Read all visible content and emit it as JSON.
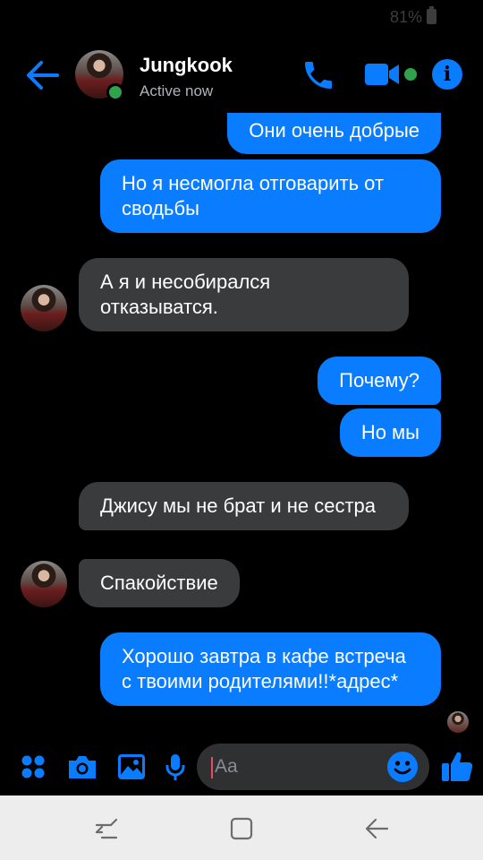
{
  "status_bar": {
    "battery": "81%"
  },
  "header": {
    "contact_name": "Jungkook",
    "status": "Active now",
    "icons": [
      "back-arrow-icon",
      "phone-icon",
      "video-camera-icon",
      "info-icon"
    ]
  },
  "messages": [
    {
      "side": "outgoing",
      "text": "Они очень добрые"
    },
    {
      "side": "outgoing",
      "text": "Но я несмогла отговарить от сводьбы"
    },
    {
      "side": "incoming",
      "text": "А я и несобирался отказыватся."
    },
    {
      "side": "outgoing",
      "text": "Почему?"
    },
    {
      "side": "outgoing",
      "text": "Но мы"
    },
    {
      "side": "incoming",
      "text": "Джису мы не брат и не сестра"
    },
    {
      "side": "incoming",
      "text": "Спакойствие"
    },
    {
      "side": "outgoing",
      "text": "Хорошо завтра в кафе встреча с твоими родителями!!*адрес*"
    }
  ],
  "composer": {
    "placeholder": "Aa",
    "icons": [
      "menu-dots-icon",
      "camera-icon",
      "gallery-icon",
      "microphone-icon",
      "emoji-icon",
      "like-icon"
    ]
  },
  "colors": {
    "accent": "#0a7cff",
    "incoming_bubble": "#3a3b3c",
    "online": "#31a24c",
    "background": "#000000"
  },
  "nav_bar": {
    "icons": [
      "recent-apps-icon",
      "home-icon",
      "back-icon"
    ]
  }
}
